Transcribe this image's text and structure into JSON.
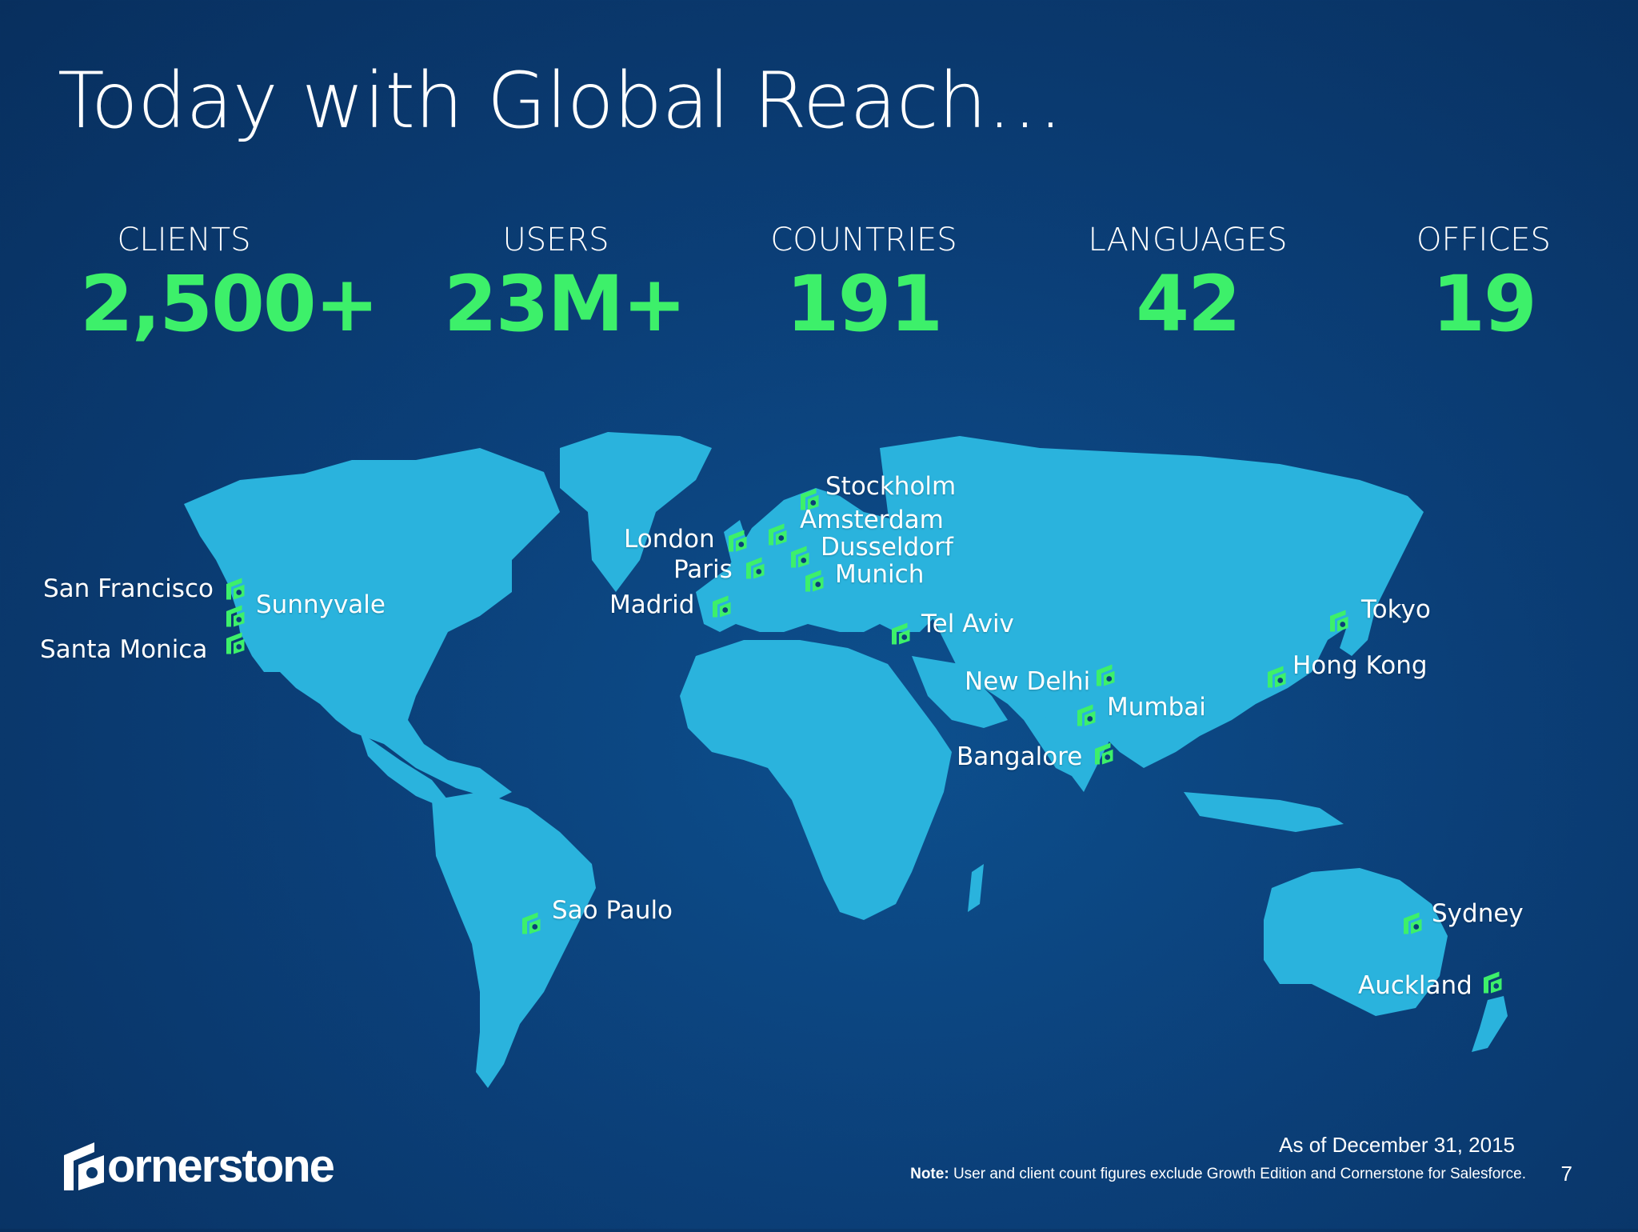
{
  "title": "Today with Global Reach…",
  "stats": [
    {
      "label": "CLIENTS",
      "value": "2,500+"
    },
    {
      "label": "USERS",
      "value": "23M+"
    },
    {
      "label": "COUNTRIES",
      "value": "191"
    },
    {
      "label": "LANGUAGES",
      "value": "42"
    },
    {
      "label": "OFFICES",
      "value": "19"
    }
  ],
  "map": {
    "cities": {
      "stockholm": "Stockholm",
      "amsterdam": "Amsterdam",
      "london": "London",
      "dusseldorf": "Dusseldorf",
      "paris": "Paris",
      "munich": "Munich",
      "madrid": "Madrid",
      "san_francisco": "San Francisco",
      "sunnyvale": "Sunnyvale",
      "santa_monica": "Santa Monica",
      "tel_aviv": "Tel Aviv",
      "tokyo": "Tokyo",
      "hong_kong": "Hong Kong",
      "new_delhi": "New Delhi",
      "mumbai": "Mumbai",
      "bangalore": "Bangalore",
      "sao_paulo": "Sao Paulo",
      "sydney": "Sydney",
      "auckland": "Auckland"
    },
    "colors": {
      "land": "#2ab3dd",
      "marker": "#3df06a",
      "ocean": "#0b3f78"
    },
    "marker_icon": "cornerstone-marker-icon"
  },
  "footer": {
    "date": "As of December 31, 2015",
    "note_label": "Note:",
    "note_text": "User and client count figures exclude Growth Edition and Cornerstone for Salesforce.",
    "page_number": "7"
  },
  "logo": {
    "text": "ornerstone"
  }
}
